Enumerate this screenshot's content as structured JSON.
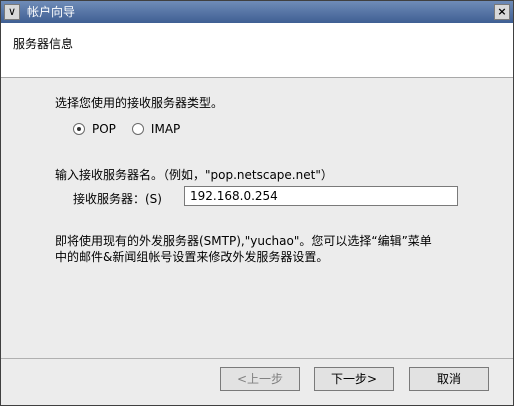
{
  "window": {
    "title": "帐户向导"
  },
  "header": {
    "heading": "服务器信息"
  },
  "main": {
    "prompt_type": "选择您使用的接收服务器类型。",
    "radio_pop": "POP",
    "radio_imap": "IMAP",
    "prompt_name": "输入接收服务器名。（例如，\"pop.netscape.net\"）",
    "server_label": "接收服务器：(S)",
    "server_value": "192.168.0.254",
    "info_line1": "即将使用现有的外发服务器(SMTP),\"yuchao\"。您可以选择“编辑”菜单",
    "info_line2": "中的邮件&新闻组帐号设置来修改外发服务器设置。"
  },
  "buttons": {
    "back": "<上一步",
    "next": "下一步>",
    "cancel": "取消"
  },
  "selected_server_type": "POP"
}
